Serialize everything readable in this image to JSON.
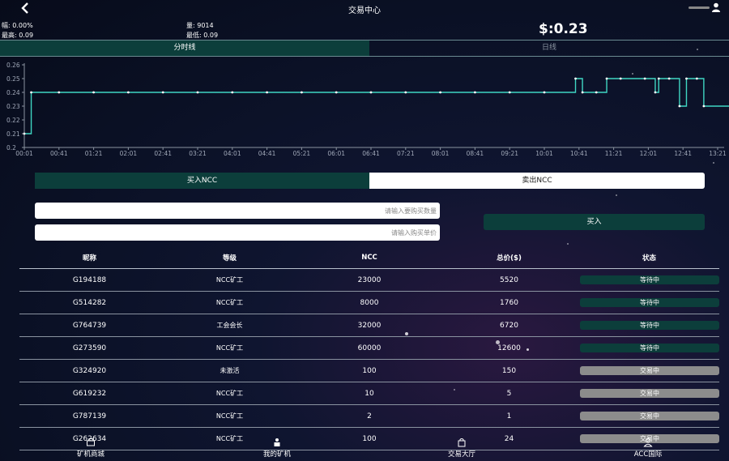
{
  "header": {
    "title": "交易中心"
  },
  "stats": {
    "change_label": "幅:",
    "change_value": "0.00%",
    "volume_label": "量:",
    "volume_value": "9014",
    "high_label": "最高:",
    "high_value": "0.09",
    "low_label": "最低:",
    "low_value": "0.09",
    "price": "$:0.23"
  },
  "chart_tabs": [
    "分时线",
    "日线"
  ],
  "chart_data": {
    "type": "line",
    "x_ticks": [
      "00:01",
      "00:41",
      "01:21",
      "02:01",
      "02:41",
      "03:21",
      "04:01",
      "04:41",
      "05:21",
      "06:01",
      "06:41",
      "07:21",
      "08:01",
      "08:41",
      "09:21",
      "10:01",
      "10:41",
      "11:21",
      "12:01",
      "12:41",
      "13:21"
    ],
    "y_ticks": [
      "0.2",
      "0.21",
      "0.22",
      "0.23",
      "0.24",
      "0.25",
      "0.26"
    ],
    "ylim": [
      0.2,
      0.26
    ],
    "series": [
      {
        "values": [
          0.21,
          0.24,
          0.24,
          0.24,
          0.24,
          0.24,
          0.24,
          0.24,
          0.24,
          0.24,
          0.24,
          0.24,
          0.24,
          0.24,
          0.24,
          0.24,
          0.24,
          0.25,
          0.24,
          0.24,
          0.25,
          0.25,
          0.25,
          0.24,
          0.25,
          0.25,
          0.23,
          0.25,
          0.25,
          0.23,
          0.23
        ],
        "x": [
          0,
          0.2,
          1,
          2,
          3,
          4,
          5,
          6,
          7,
          8,
          9,
          10,
          11,
          12,
          13,
          14,
          15,
          15.9,
          16.1,
          16.5,
          16.8,
          17.2,
          17.9,
          18.2,
          18.3,
          18.6,
          18.9,
          19.1,
          19.4,
          19.6,
          20.8
        ]
      }
    ]
  },
  "trade_tabs": {
    "buy": "买入NCC",
    "sell": "卖出NCC"
  },
  "form": {
    "amount_placeholder": "请输入要购买数量",
    "price_placeholder": "请输入购买单价",
    "buy_button": "买入"
  },
  "table": {
    "headers": [
      "昵称",
      "等级",
      "NCC",
      "总价($)",
      "状态"
    ],
    "rows": [
      {
        "name": "G194188",
        "level": "NCC矿工",
        "ncc": "23000",
        "total": "5520",
        "status": "等待中",
        "kind": "wait"
      },
      {
        "name": "G514282",
        "level": "NCC矿工",
        "ncc": "8000",
        "total": "1760",
        "status": "等待中",
        "kind": "wait"
      },
      {
        "name": "G764739",
        "level": "工会会长",
        "ncc": "32000",
        "total": "6720",
        "status": "等待中",
        "kind": "wait"
      },
      {
        "name": "G273590",
        "level": "NCC矿工",
        "ncc": "60000",
        "total": "12600",
        "status": "等待中",
        "kind": "wait"
      },
      {
        "name": "G324920",
        "level": "未激活",
        "ncc": "100",
        "total": "150",
        "status": "交易中",
        "kind": "trade"
      },
      {
        "name": "G619232",
        "level": "NCC矿工",
        "ncc": "10",
        "total": "5",
        "status": "交易中",
        "kind": "trade"
      },
      {
        "name": "G787139",
        "level": "NCC矿工",
        "ncc": "2",
        "total": "1",
        "status": "交易中",
        "kind": "trade"
      },
      {
        "name": "G262634",
        "level": "NCC矿工",
        "ncc": "100",
        "total": "24",
        "status": "交易中",
        "kind": "trade"
      }
    ]
  },
  "nav": [
    {
      "label": "矿机商城",
      "icon": "shop-icon"
    },
    {
      "label": "我的矿机",
      "icon": "miner-icon"
    },
    {
      "label": "交易大厅",
      "icon": "bag-icon"
    },
    {
      "label": "ACC国际",
      "icon": "person-icon"
    }
  ],
  "colors": {
    "accent": "#0c3e3b",
    "line": "#3fd6c3",
    "pending": "#8c8c8c"
  }
}
